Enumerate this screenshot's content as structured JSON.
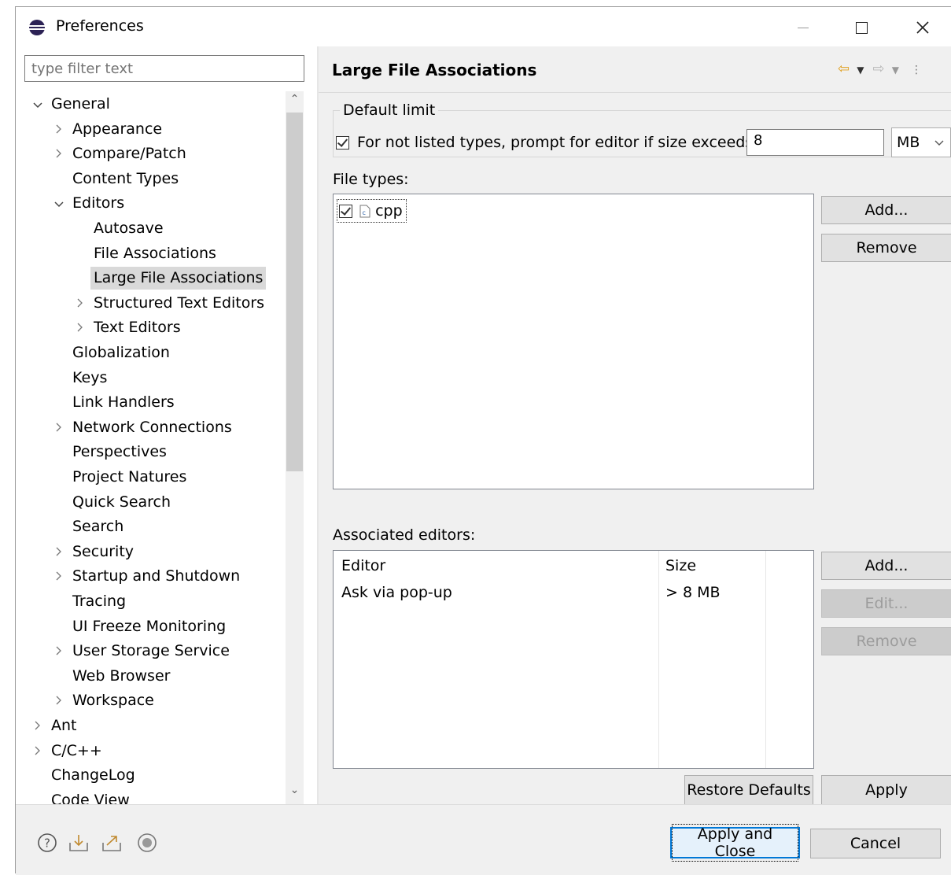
{
  "window": {
    "title": "Preferences",
    "controls": {
      "minimize": "—",
      "maximize": "☐",
      "close": "✕"
    }
  },
  "filter": {
    "placeholder": "type filter text"
  },
  "tree": [
    {
      "label": "General",
      "depth": 0,
      "toggle": "expanded"
    },
    {
      "label": "Appearance",
      "depth": 1,
      "toggle": "collapsed"
    },
    {
      "label": "Compare/Patch",
      "depth": 1,
      "toggle": "collapsed"
    },
    {
      "label": "Content Types",
      "depth": 1,
      "toggle": "none"
    },
    {
      "label": "Editors",
      "depth": 1,
      "toggle": "expanded"
    },
    {
      "label": "Autosave",
      "depth": 2,
      "toggle": "none"
    },
    {
      "label": "File Associations",
      "depth": 2,
      "toggle": "none"
    },
    {
      "label": "Large File Associations",
      "depth": 2,
      "toggle": "none",
      "selected": true
    },
    {
      "label": "Structured Text Editors",
      "depth": 2,
      "toggle": "collapsed"
    },
    {
      "label": "Text Editors",
      "depth": 2,
      "toggle": "collapsed"
    },
    {
      "label": "Globalization",
      "depth": 1,
      "toggle": "none"
    },
    {
      "label": "Keys",
      "depth": 1,
      "toggle": "none"
    },
    {
      "label": "Link Handlers",
      "depth": 1,
      "toggle": "none"
    },
    {
      "label": "Network Connections",
      "depth": 1,
      "toggle": "collapsed"
    },
    {
      "label": "Perspectives",
      "depth": 1,
      "toggle": "none"
    },
    {
      "label": "Project Natures",
      "depth": 1,
      "toggle": "none"
    },
    {
      "label": "Quick Search",
      "depth": 1,
      "toggle": "none"
    },
    {
      "label": "Search",
      "depth": 1,
      "toggle": "none"
    },
    {
      "label": "Security",
      "depth": 1,
      "toggle": "collapsed"
    },
    {
      "label": "Startup and Shutdown",
      "depth": 1,
      "toggle": "collapsed"
    },
    {
      "label": "Tracing",
      "depth": 1,
      "toggle": "none"
    },
    {
      "label": "UI Freeze Monitoring",
      "depth": 1,
      "toggle": "none"
    },
    {
      "label": "User Storage Service",
      "depth": 1,
      "toggle": "collapsed"
    },
    {
      "label": "Web Browser",
      "depth": 1,
      "toggle": "none"
    },
    {
      "label": "Workspace",
      "depth": 1,
      "toggle": "collapsed"
    },
    {
      "label": "Ant",
      "depth": 0,
      "toggle": "collapsed"
    },
    {
      "label": "C/C++",
      "depth": 0,
      "toggle": "collapsed"
    },
    {
      "label": "ChangeLog",
      "depth": 0,
      "toggle": "none"
    },
    {
      "label": "Code View",
      "depth": 0,
      "toggle": "none"
    }
  ],
  "page": {
    "title": "Large File Associations",
    "default_limit": {
      "group_label": "Default limit",
      "checkbox_label": "For not listed types, prompt for editor if size exceeds:",
      "checked": true,
      "size_value": "8",
      "unit": "MB"
    },
    "file_types": {
      "label": "File types:",
      "items": [
        {
          "name": "cpp",
          "checked": true
        }
      ],
      "add_label": "Add...",
      "remove_label": "Remove"
    },
    "associated_editors": {
      "label": "Associated editors:",
      "columns": [
        "Editor",
        "Size"
      ],
      "rows": [
        {
          "editor": "Ask via pop-up",
          "size": "> 8 MB"
        }
      ],
      "add_label": "Add...",
      "edit_label": "Edit...",
      "remove_label": "Remove"
    },
    "restore_defaults_label": "Restore Defaults",
    "apply_label": "Apply"
  },
  "footer": {
    "apply_close_label": "Apply and Close",
    "cancel_label": "Cancel"
  },
  "colors": {
    "accent": "#0078d7",
    "selection": "#d9d9d9",
    "eclipse_purple": "#2c2255"
  }
}
